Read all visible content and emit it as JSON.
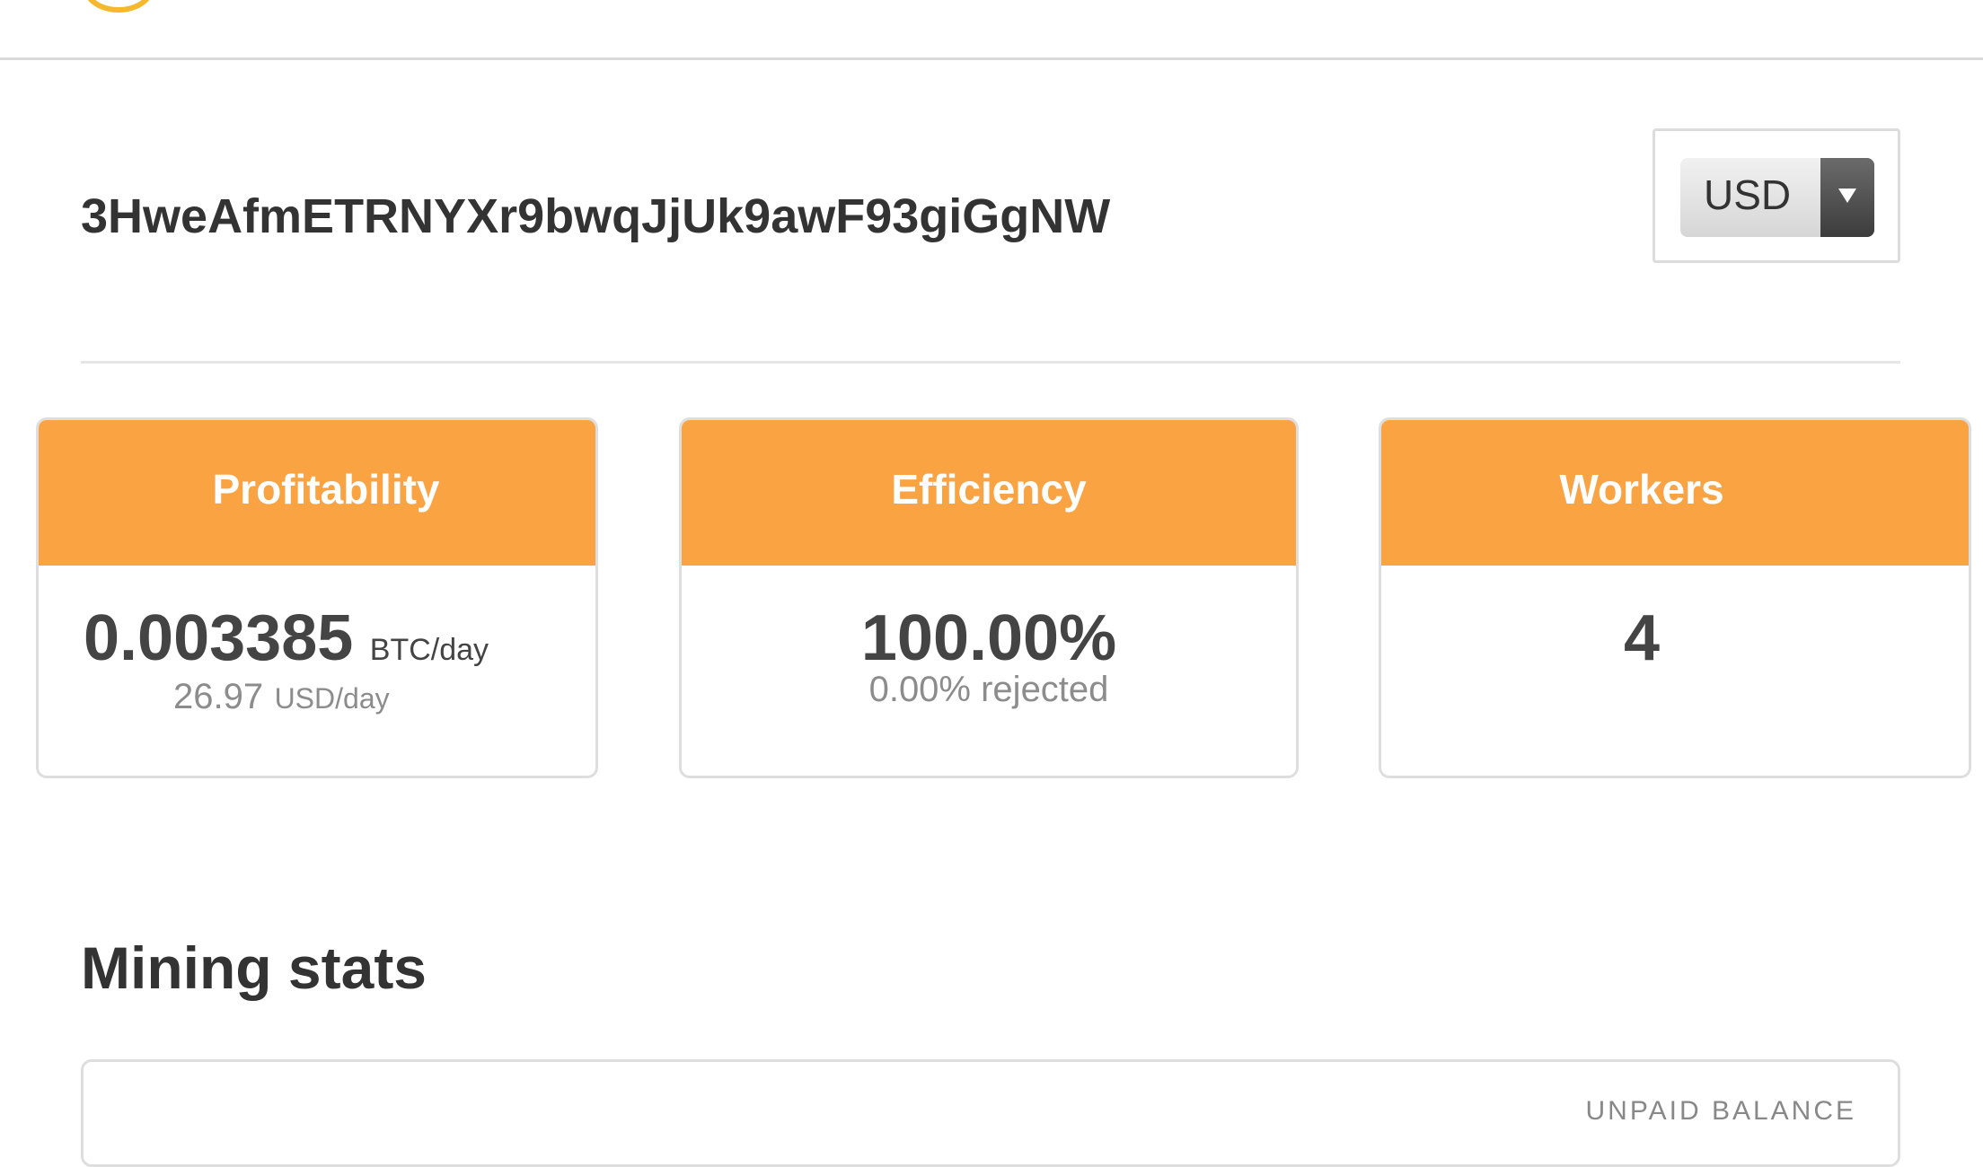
{
  "header": {
    "logo_icon": "pool-logo-icon"
  },
  "account": {
    "address": "3HweAfmETRNYXr9bwqJjUk9awF93giGgNW"
  },
  "currency": {
    "selected": "USD"
  },
  "cards": {
    "profitability": {
      "title": "Profitability",
      "value": "0.003385",
      "unit": "BTC/day",
      "sub_value": "26.97",
      "sub_unit": "USD/day"
    },
    "efficiency": {
      "title": "Efficiency",
      "value": "100.00%",
      "sub_text": "0.00% rejected"
    },
    "workers": {
      "title": "Workers",
      "value": "4"
    }
  },
  "mining_stats": {
    "title": "Mining stats",
    "unpaid_balance_label": "UNPAID BALANCE"
  },
  "colors": {
    "accent": "#f9a343",
    "logo": "#f5b72c"
  }
}
